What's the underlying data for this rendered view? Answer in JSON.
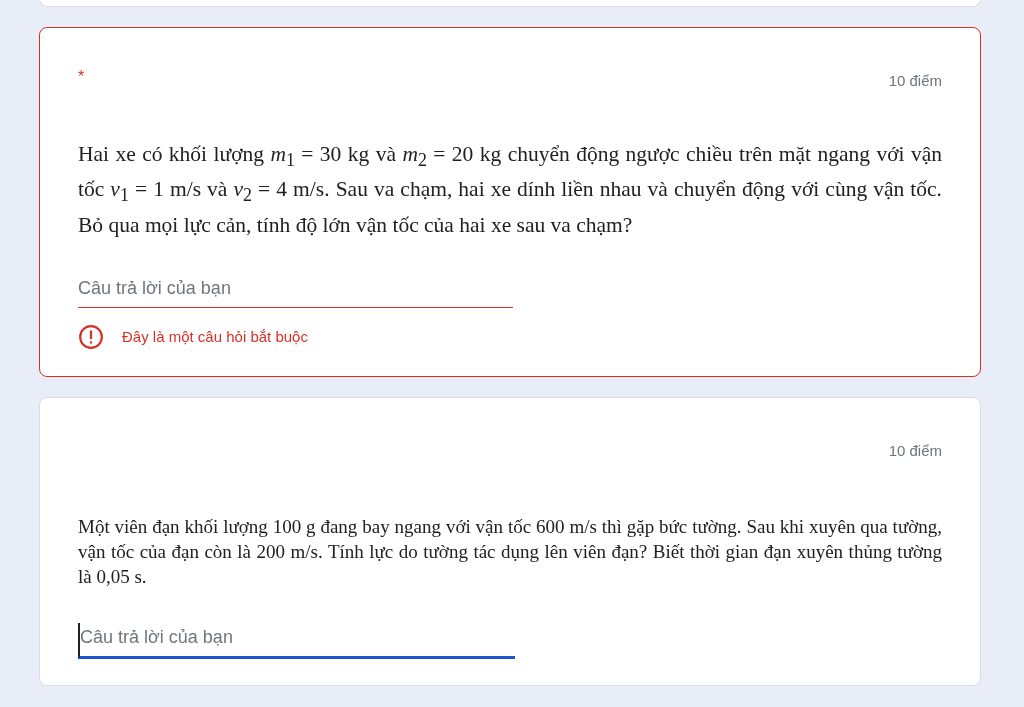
{
  "questions": [
    {
      "required_mark": "*",
      "points": "10 điểm",
      "text": "Hai xe có khối lượng *m*$_{1}$ = 30 kg và *m*$_{2}$ = 20 kg chuyển động ngược chiều trên mặt ngang với vận tốc *v*$_{1}$ = 1 m/s và *v*$_{2}$ = 4 m/s. Sau va chạm, hai xe dính liền nhau và chuyển động với cùng vận tốc. Bỏ qua mọi lực cản, tính độ lớn vận tốc của hai xe sau va chạm?",
      "placeholder": "Câu trả lời của bạn",
      "focused": false,
      "error": "Đây là một câu hỏi bắt buộc"
    },
    {
      "points": "10 điểm",
      "text": "Một viên đạn khối lượng 100 g đang bay ngang với vận tốc 600 m/s thì gặp bức tường. Sau khi xuyên qua tường, vận tốc của đạn còn là 200 m/s. Tính lực do tường tác dụng lên viên đạn? Biết thời gian đạn xuyên thủng tường là 0,05 s.",
      "placeholder": "Câu trả lời của bạn",
      "focused": true
    }
  ]
}
